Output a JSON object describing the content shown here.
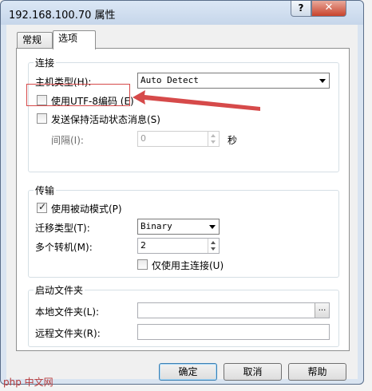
{
  "window": {
    "title": "192.168.100.70 属性",
    "help_label": "?",
    "close_label": "✕"
  },
  "tabs": [
    {
      "label": "常规"
    },
    {
      "label": "选项"
    }
  ],
  "connection": {
    "group_title": "连接",
    "host_type_label": "主机类型(H):",
    "host_type_value": "Auto Detect",
    "utf8_label": "使用UTF-8编码 (E)",
    "utf8_checked": false,
    "keepalive_label": "发送保持活动状态消息(S)",
    "keepalive_checked": false,
    "interval_label": "间隔(I):",
    "interval_value": "0",
    "interval_unit": "秒"
  },
  "transfer": {
    "group_title": "传输",
    "passive_label": "使用被动模式(P)",
    "passive_checked": true,
    "transfer_type_label": "迁移类型(T):",
    "transfer_type_value": "Binary",
    "multi_label": "多个转机(M):",
    "multi_value": "2",
    "main_only_label": "仅使用主连接(U)",
    "main_only_checked": false
  },
  "startup": {
    "group_title": "启动文件夹",
    "local_label": "本地文件夹(L):",
    "local_value": "",
    "browse_label": "...",
    "remote_label": "远程文件夹(R):",
    "remote_value": ""
  },
  "buttons": {
    "ok": "确定",
    "cancel": "取消",
    "help": "帮助"
  },
  "watermark": "php 中文网",
  "colors": {
    "annotation": "#d64a4a",
    "accent": "#3c7fb1"
  }
}
